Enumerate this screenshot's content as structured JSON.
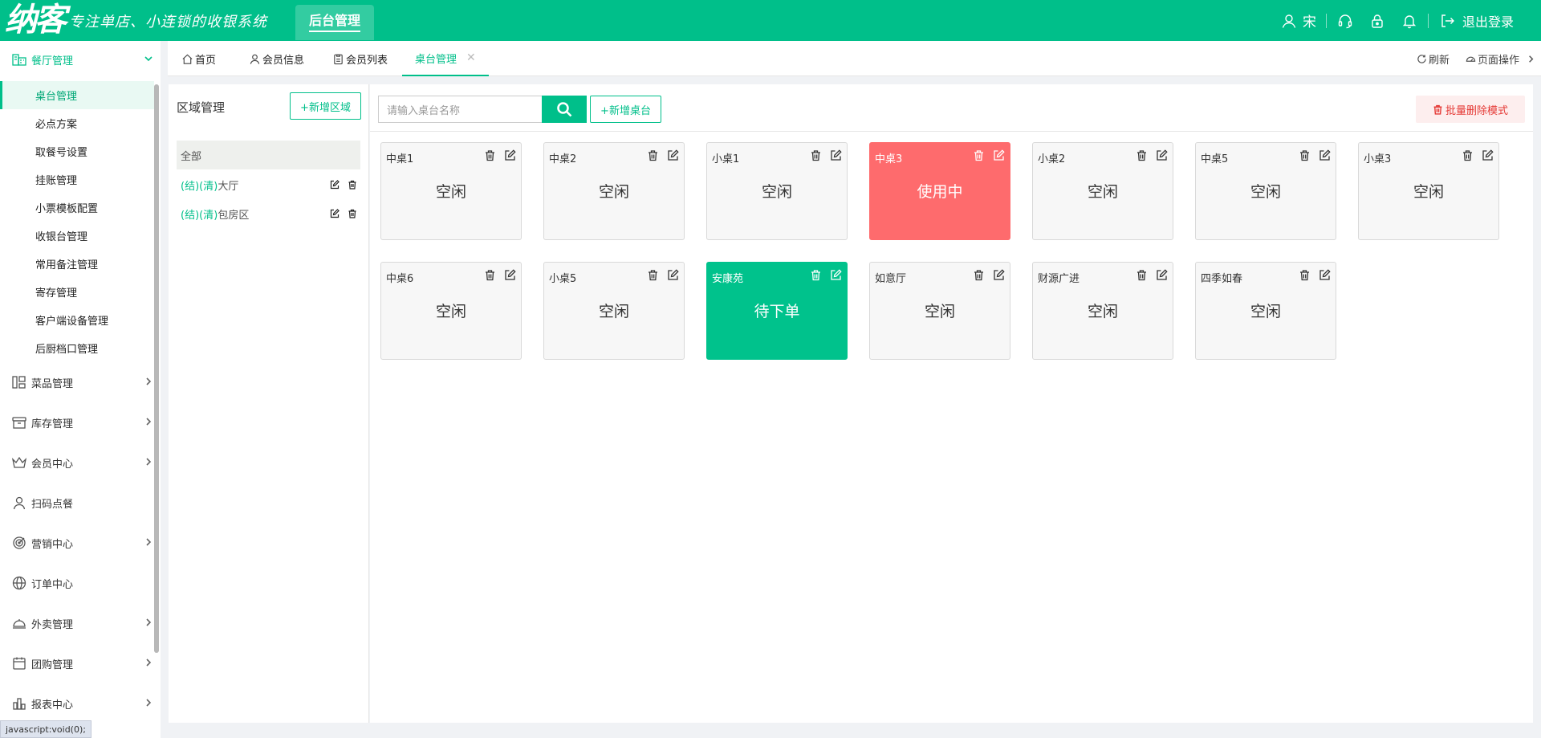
{
  "header": {
    "logo": "纳客",
    "slogan": "专注单店、小连锁的收银系统",
    "system_tab": "后台管理",
    "user": "宋",
    "logout": "退出登录"
  },
  "sidebar": {
    "open_group": "餐厅管理",
    "sub_items": [
      "桌台管理",
      "必点方案",
      "取餐号设置",
      "挂账管理",
      "小票模板配置",
      "收银台管理",
      "常用备注管理",
      "寄存管理",
      "客户端设备管理",
      "后厨档口管理"
    ],
    "groups": [
      "菜品管理",
      "库存管理",
      "会员中心",
      "扫码点餐",
      "营销中心",
      "订单中心",
      "外卖管理",
      "团购管理",
      "报表中心"
    ]
  },
  "status_bar": "javascript:void(0);",
  "tabs": {
    "items": [
      "首页",
      "会员信息",
      "会员列表",
      "桌台管理"
    ],
    "refresh": "刷新",
    "page_ops": "页面操作"
  },
  "area": {
    "title": "区域管理",
    "add_button": "+新增区域",
    "all": "全部",
    "items": [
      {
        "tag1": "(结)",
        "tag2": "(清)",
        "name": "大厅"
      },
      {
        "tag1": "(结)",
        "tag2": "(清)",
        "name": "包房区"
      }
    ]
  },
  "toolbar": {
    "search_placeholder": "请输入桌台名称",
    "add_table": "+新增桌台",
    "bulk_delete": "批量删除模式"
  },
  "tables": [
    {
      "name": "中桌1",
      "status": "空闲",
      "state": "free"
    },
    {
      "name": "中桌2",
      "status": "空闲",
      "state": "free"
    },
    {
      "name": "小桌1",
      "status": "空闲",
      "state": "free"
    },
    {
      "name": "中桌3",
      "status": "使用中",
      "state": "busy"
    },
    {
      "name": "小桌2",
      "status": "空闲",
      "state": "free"
    },
    {
      "name": "中桌5",
      "status": "空闲",
      "state": "free"
    },
    {
      "name": "小桌3",
      "status": "空闲",
      "state": "free"
    },
    {
      "name": "中桌6",
      "status": "空闲",
      "state": "free"
    },
    {
      "name": "小桌5",
      "status": "空闲",
      "state": "free"
    },
    {
      "name": "安康苑",
      "status": "待下单",
      "state": "pending"
    },
    {
      "name": "如意厅",
      "status": "空闲",
      "state": "free"
    },
    {
      "name": "财源广进",
      "status": "空闲",
      "state": "free"
    },
    {
      "name": "四季如春",
      "status": "空闲",
      "state": "free"
    }
  ],
  "colors": {
    "primary": "#00bf8a",
    "busy": "#fe6b6d",
    "pending": "#00c28c",
    "danger": "#e53935"
  }
}
